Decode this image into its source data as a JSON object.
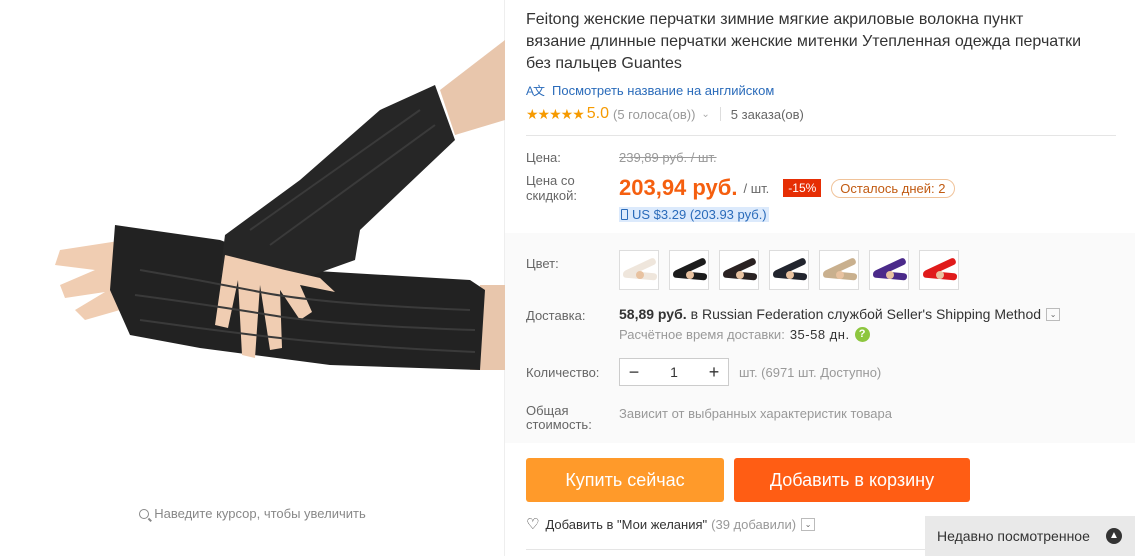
{
  "gallery": {
    "zoom_hint": "Наведите курсор, чтобы увеличить"
  },
  "product": {
    "title": "Feitong женские перчатки зимние мягкие акриловые волокна пункт вязание длинные перчатки женские митенки Утепленная одежда перчатки без пальцев Guantes",
    "translate_icon": "A文",
    "translate_link": "Посмотреть название на английском",
    "stars": "★★★★★",
    "rating": "5.0",
    "votes": "(5 голоса(ов))",
    "orders": "5 заказа(ов)"
  },
  "price": {
    "label": "Цена:",
    "old": "239,89 руб. / шт.",
    "discount_label": "Цена со скидкой:",
    "new": "203,94 руб.",
    "per_unit": "/ шт.",
    "discount_badge": "-15%",
    "days_left": "Осталось дней: 2",
    "usd": "US $3.29 (203.93 руб.)"
  },
  "color": {
    "label": "Цвет:",
    "swatches": [
      {
        "color": "#efe6dc",
        "name": "beige-light"
      },
      {
        "color": "#1c1c1c",
        "name": "black"
      },
      {
        "color": "#2a2222",
        "name": "black-dark"
      },
      {
        "color": "#22252e",
        "name": "navy-black"
      },
      {
        "color": "#c9b08e",
        "name": "khaki"
      },
      {
        "color": "#4b2a8a",
        "name": "purple"
      },
      {
        "color": "#e01b1b",
        "name": "red"
      }
    ]
  },
  "shipping": {
    "label": "Доставка:",
    "price": "58,89 руб.",
    "text": "в Russian Federation службой Seller's Shipping Method",
    "time_label": "Расчётное время доставки:",
    "time_days": "35-58 дн.",
    "help": "?"
  },
  "quantity": {
    "label": "Количество:",
    "minus": "−",
    "value": "1",
    "plus": "+",
    "available": "шт. (6971 шт. Доступно)"
  },
  "total": {
    "label": "Общая стоимость:",
    "value": "Зависит от выбранных характеристик товара"
  },
  "actions": {
    "buy": "Купить сейчас",
    "cart": "Добавить в корзину",
    "wishlist": "Добавить в \"Мои желания\"",
    "wishlist_count": "(39 добавили)"
  },
  "recent": {
    "label": "Недавно посмотренное",
    "icon": "▲"
  }
}
